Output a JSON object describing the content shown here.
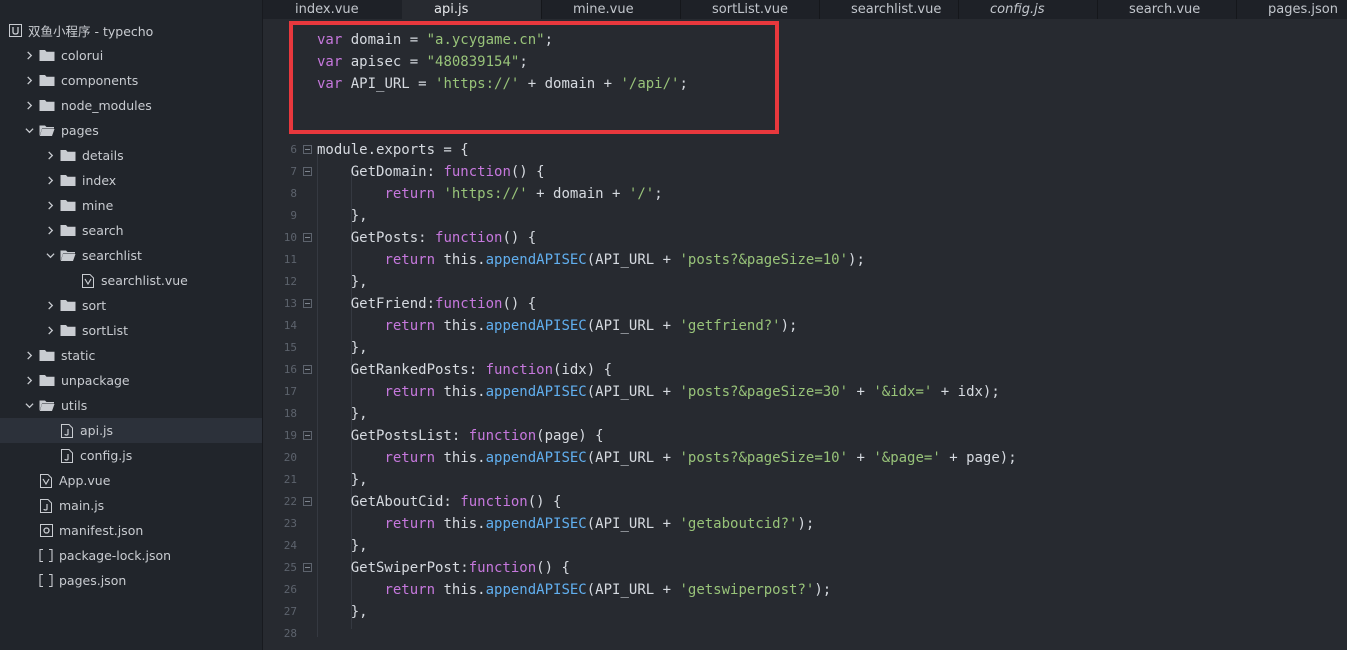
{
  "sidebar": {
    "project_title": "双鱼小程序 - typecho",
    "items": [
      {
        "label": "colorui",
        "type": "folder",
        "depth": 0,
        "expanded": false
      },
      {
        "label": "components",
        "type": "folder",
        "depth": 0,
        "expanded": false
      },
      {
        "label": "node_modules",
        "type": "folder",
        "depth": 0,
        "expanded": false
      },
      {
        "label": "pages",
        "type": "folder",
        "depth": 0,
        "expanded": true
      },
      {
        "label": "details",
        "type": "folder",
        "depth": 1,
        "expanded": false
      },
      {
        "label": "index",
        "type": "folder",
        "depth": 1,
        "expanded": false
      },
      {
        "label": "mine",
        "type": "folder",
        "depth": 1,
        "expanded": false
      },
      {
        "label": "search",
        "type": "folder",
        "depth": 1,
        "expanded": false
      },
      {
        "label": "searchlist",
        "type": "folder",
        "depth": 1,
        "expanded": true
      },
      {
        "label": "searchlist.vue",
        "type": "vue",
        "depth": 2
      },
      {
        "label": "sort",
        "type": "folder",
        "depth": 1,
        "expanded": false
      },
      {
        "label": "sortList",
        "type": "folder",
        "depth": 1,
        "expanded": false
      },
      {
        "label": "static",
        "type": "folder",
        "depth": 0,
        "expanded": false
      },
      {
        "label": "unpackage",
        "type": "folder",
        "depth": 0,
        "expanded": false
      },
      {
        "label": "utils",
        "type": "folder",
        "depth": 0,
        "expanded": true
      },
      {
        "label": "api.js",
        "type": "js",
        "depth": 1,
        "selected": true
      },
      {
        "label": "config.js",
        "type": "js",
        "depth": 1
      },
      {
        "label": "App.vue",
        "type": "vue",
        "depth": 0
      },
      {
        "label": "main.js",
        "type": "js",
        "depth": 0
      },
      {
        "label": "manifest.json",
        "type": "manifest",
        "depth": 0
      },
      {
        "label": "package-lock.json",
        "type": "json",
        "depth": 0
      },
      {
        "label": "pages.json",
        "type": "json",
        "depth": 0
      }
    ]
  },
  "tabs": [
    {
      "label": "index.vue",
      "active": false,
      "italic": false
    },
    {
      "label": "api.js",
      "active": true,
      "italic": false
    },
    {
      "label": "mine.vue",
      "active": false,
      "italic": false
    },
    {
      "label": "sortList.vue",
      "active": false,
      "italic": false
    },
    {
      "label": "searchlist.vue",
      "active": false,
      "italic": false
    },
    {
      "label": "config.js",
      "active": false,
      "italic": true
    },
    {
      "label": "search.vue",
      "active": false,
      "italic": false
    },
    {
      "label": "pages.json",
      "active": false,
      "italic": false
    }
  ],
  "code_lines": [
    {
      "n": "",
      "fold": false,
      "tokens": [
        [
          "kw",
          "var"
        ],
        [
          "pl",
          " domain = "
        ],
        [
          "st",
          "\"a.ycygame.cn\""
        ],
        [
          "pl",
          ";"
        ]
      ]
    },
    {
      "n": "",
      "fold": false,
      "tokens": [
        [
          "kw",
          "var"
        ],
        [
          "pl",
          " apisec = "
        ],
        [
          "st",
          "\"480839154\""
        ],
        [
          "pl",
          ";"
        ]
      ]
    },
    {
      "n": "",
      "fold": false,
      "tokens": [
        [
          "kw",
          "var"
        ],
        [
          "pl",
          " API_URL = "
        ],
        [
          "st",
          "'https://'"
        ],
        [
          "pl",
          " + domain + "
        ],
        [
          "st",
          "'/api/'"
        ],
        [
          "pl",
          ";"
        ]
      ]
    },
    {
      "n": "",
      "fold": false,
      "tokens": []
    },
    {
      "n": "",
      "fold": false,
      "tokens": []
    },
    {
      "n": "6",
      "fold": true,
      "tokens": [
        [
          "pl",
          "module.exports = {"
        ]
      ]
    },
    {
      "n": "7",
      "fold": true,
      "tokens": [
        [
          "pl",
          "    GetDomain: "
        ],
        [
          "kw",
          "function"
        ],
        [
          "pl",
          "() {"
        ]
      ]
    },
    {
      "n": "8",
      "fold": false,
      "tokens": [
        [
          "pl",
          "        "
        ],
        [
          "kw",
          "return"
        ],
        [
          "pl",
          " "
        ],
        [
          "st",
          "'https://'"
        ],
        [
          "pl",
          " + domain + "
        ],
        [
          "st",
          "'/'"
        ],
        [
          "pl",
          ";"
        ]
      ]
    },
    {
      "n": "9",
      "fold": false,
      "tokens": [
        [
          "pl",
          "    },"
        ]
      ]
    },
    {
      "n": "10",
      "fold": true,
      "tokens": [
        [
          "pl",
          "    GetPosts: "
        ],
        [
          "kw",
          "function"
        ],
        [
          "pl",
          "() {"
        ]
      ]
    },
    {
      "n": "11",
      "fold": false,
      "tokens": [
        [
          "pl",
          "        "
        ],
        [
          "kw",
          "return"
        ],
        [
          "pl",
          " this."
        ],
        [
          "fn",
          "appendAPISEC"
        ],
        [
          "pl",
          "(API_URL + "
        ],
        [
          "st",
          "'posts?&pageSize=10'"
        ],
        [
          "pl",
          ");"
        ]
      ]
    },
    {
      "n": "12",
      "fold": false,
      "tokens": [
        [
          "pl",
          "    },"
        ]
      ]
    },
    {
      "n": "13",
      "fold": true,
      "tokens": [
        [
          "pl",
          "    GetFriend:"
        ],
        [
          "kw",
          "function"
        ],
        [
          "pl",
          "() {"
        ]
      ]
    },
    {
      "n": "14",
      "fold": false,
      "tokens": [
        [
          "pl",
          "        "
        ],
        [
          "kw",
          "return"
        ],
        [
          "pl",
          " this."
        ],
        [
          "fn",
          "appendAPISEC"
        ],
        [
          "pl",
          "(API_URL + "
        ],
        [
          "st",
          "'getfriend?'"
        ],
        [
          "pl",
          ");"
        ]
      ]
    },
    {
      "n": "15",
      "fold": false,
      "tokens": [
        [
          "pl",
          "    },"
        ]
      ]
    },
    {
      "n": "16",
      "fold": true,
      "tokens": [
        [
          "pl",
          "    GetRankedPosts: "
        ],
        [
          "kw",
          "function"
        ],
        [
          "pl",
          "(idx) {"
        ]
      ]
    },
    {
      "n": "17",
      "fold": false,
      "tokens": [
        [
          "pl",
          "        "
        ],
        [
          "kw",
          "return"
        ],
        [
          "pl",
          " this."
        ],
        [
          "fn",
          "appendAPISEC"
        ],
        [
          "pl",
          "(API_URL + "
        ],
        [
          "st",
          "'posts?&pageSize=30'"
        ],
        [
          "pl",
          " + "
        ],
        [
          "st",
          "'&idx='"
        ],
        [
          "pl",
          " + idx);"
        ]
      ]
    },
    {
      "n": "18",
      "fold": false,
      "tokens": [
        [
          "pl",
          "    },"
        ]
      ]
    },
    {
      "n": "19",
      "fold": true,
      "tokens": [
        [
          "pl",
          "    GetPostsList: "
        ],
        [
          "kw",
          "function"
        ],
        [
          "pl",
          "(page) {"
        ]
      ]
    },
    {
      "n": "20",
      "fold": false,
      "tokens": [
        [
          "pl",
          "        "
        ],
        [
          "kw",
          "return"
        ],
        [
          "pl",
          " this."
        ],
        [
          "fn",
          "appendAPISEC"
        ],
        [
          "pl",
          "(API_URL + "
        ],
        [
          "st",
          "'posts?&pageSize=10'"
        ],
        [
          "pl",
          " + "
        ],
        [
          "st",
          "'&page='"
        ],
        [
          "pl",
          " + page);"
        ]
      ]
    },
    {
      "n": "21",
      "fold": false,
      "tokens": [
        [
          "pl",
          "    },"
        ]
      ]
    },
    {
      "n": "22",
      "fold": true,
      "tokens": [
        [
          "pl",
          "    GetAboutCid: "
        ],
        [
          "kw",
          "function"
        ],
        [
          "pl",
          "() {"
        ]
      ]
    },
    {
      "n": "23",
      "fold": false,
      "tokens": [
        [
          "pl",
          "        "
        ],
        [
          "kw",
          "return"
        ],
        [
          "pl",
          " this."
        ],
        [
          "fn",
          "appendAPISEC"
        ],
        [
          "pl",
          "(API_URL + "
        ],
        [
          "st",
          "'getaboutcid?'"
        ],
        [
          "pl",
          ");"
        ]
      ]
    },
    {
      "n": "24",
      "fold": false,
      "tokens": [
        [
          "pl",
          "    },"
        ]
      ]
    },
    {
      "n": "25",
      "fold": true,
      "tokens": [
        [
          "pl",
          "    GetSwiperPost:"
        ],
        [
          "kw",
          "function"
        ],
        [
          "pl",
          "() {"
        ]
      ]
    },
    {
      "n": "26",
      "fold": false,
      "tokens": [
        [
          "pl",
          "        "
        ],
        [
          "kw",
          "return"
        ],
        [
          "pl",
          " this."
        ],
        [
          "fn",
          "appendAPISEC"
        ],
        [
          "pl",
          "(API_URL + "
        ],
        [
          "st",
          "'getswiperpost?'"
        ],
        [
          "pl",
          ");"
        ]
      ]
    },
    {
      "n": "27",
      "fold": false,
      "tokens": [
        [
          "pl",
          "    },"
        ]
      ]
    },
    {
      "n": "28",
      "fold": false,
      "tokens": []
    }
  ],
  "colors": {
    "keyword": "#c678dd",
    "string": "#98c379",
    "function": "#61afef",
    "highlight_box": "#e8383d"
  }
}
